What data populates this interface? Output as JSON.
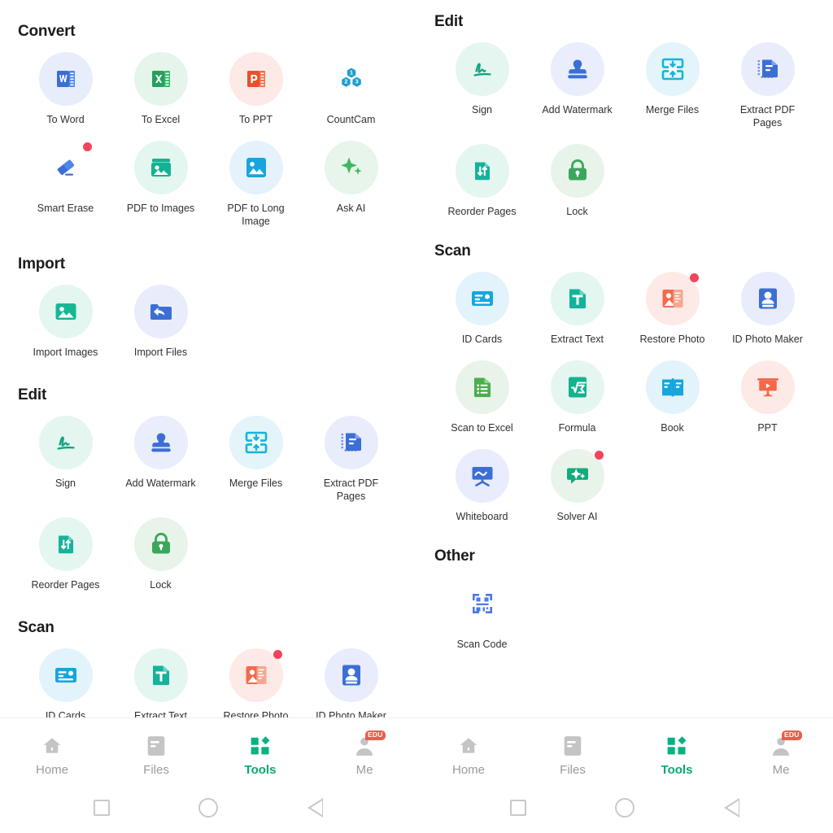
{
  "app": {
    "accent_green": "#0aa873",
    "badge_red": "#f4435a",
    "text_primary": "#2f3032",
    "text_muted": "#9a9a9a"
  },
  "left_screen": {
    "sections": [
      {
        "title": "Convert",
        "items": [
          {
            "label": "To Word",
            "icon": "word-icon",
            "bg": "#e8edfb",
            "has_badge": false
          },
          {
            "label": "To Excel",
            "icon": "excel-icon",
            "bg": "#e6f5ec",
            "has_badge": false
          },
          {
            "label": "To PPT",
            "icon": "powerpoint-icon",
            "bg": "#fdeae6",
            "has_badge": false
          },
          {
            "label": "CountCam",
            "icon": "countcam-icon",
            "bg": "transparent",
            "has_badge": false
          },
          {
            "label": "Smart Erase",
            "icon": "eraser-icon",
            "bg": "transparent",
            "has_badge": true
          },
          {
            "label": "PDF to Images",
            "icon": "image-stack-icon",
            "bg": "#e4f6f0",
            "has_badge": false
          },
          {
            "label": "PDF to Long Image",
            "icon": "long-image-icon",
            "bg": "#e5f2fb",
            "has_badge": false
          },
          {
            "label": "Ask AI",
            "icon": "sparkle-icon",
            "bg": "#e8f5ea",
            "has_badge": false
          }
        ]
      },
      {
        "title": "Import",
        "items": [
          {
            "label": "Import Images",
            "icon": "picture-icon",
            "bg": "#e4f6f0",
            "has_badge": false
          },
          {
            "label": "Import Files",
            "icon": "folder-arrow-icon",
            "bg": "#e8ecfb",
            "has_badge": false
          }
        ]
      },
      {
        "title": "Edit",
        "items": [
          {
            "label": "Sign",
            "icon": "signature-icon",
            "bg": "#e4f6ef",
            "has_badge": false
          },
          {
            "label": "Add Watermark",
            "icon": "stamp-icon",
            "bg": "#e9edfc",
            "has_badge": false
          },
          {
            "label": "Merge Files",
            "icon": "merge-icon",
            "bg": "#e3f4fa",
            "has_badge": false
          },
          {
            "label": "Extract PDF Pages",
            "icon": "extract-pages-icon",
            "bg": "#e9ecfb",
            "has_badge": false
          },
          {
            "label": "Reorder Pages",
            "icon": "reorder-icon",
            "bg": "#e4f6f0",
            "has_badge": false
          },
          {
            "label": "Lock",
            "icon": "lock-icon",
            "bg": "#e8f4ea",
            "has_badge": false
          }
        ]
      },
      {
        "title": "Scan",
        "items": [
          {
            "label": "ID Cards",
            "icon": "id-card-icon",
            "bg": "#e3f3fb",
            "has_badge": false
          },
          {
            "label": "Extract Text",
            "icon": "text-doc-icon",
            "bg": "#e3f6f0",
            "has_badge": false
          },
          {
            "label": "Restore Photo",
            "icon": "restore-photo-icon",
            "bg": "#fdeae6",
            "has_badge": true
          },
          {
            "label": "ID Photo Maker",
            "icon": "id-photo-icon",
            "bg": "#e8ecfc",
            "has_badge": false
          }
        ]
      }
    ]
  },
  "right_screen": {
    "sections": [
      {
        "title": "Edit",
        "items": [
          {
            "label": "Sign",
            "icon": "signature-icon",
            "bg": "#e4f6ef",
            "has_badge": false
          },
          {
            "label": "Add Watermark",
            "icon": "stamp-icon",
            "bg": "#e9edfc",
            "has_badge": false
          },
          {
            "label": "Merge Files",
            "icon": "merge-icon",
            "bg": "#e3f4fa",
            "has_badge": false
          },
          {
            "label": "Extract PDF Pages",
            "icon": "extract-pages-icon",
            "bg": "#e9ecfb",
            "has_badge": false
          },
          {
            "label": "Reorder Pages",
            "icon": "reorder-icon",
            "bg": "#e4f6f0",
            "has_badge": false
          },
          {
            "label": "Lock",
            "icon": "lock-icon",
            "bg": "#e8f4ea",
            "has_badge": false
          }
        ]
      },
      {
        "title": "Scan",
        "items": [
          {
            "label": "ID Cards",
            "icon": "id-card-icon",
            "bg": "#e3f3fb",
            "has_badge": false
          },
          {
            "label": "Extract Text",
            "icon": "text-doc-icon",
            "bg": "#e3f6f0",
            "has_badge": false
          },
          {
            "label": "Restore Photo",
            "icon": "restore-photo-icon",
            "bg": "#fdeae6",
            "has_badge": true
          },
          {
            "label": "ID Photo Maker",
            "icon": "id-photo-icon",
            "bg": "#e8ecfc",
            "has_badge": false
          },
          {
            "label": "Scan to Excel",
            "icon": "scan-excel-icon",
            "bg": "#e8f4ea",
            "has_badge": false
          },
          {
            "label": "Formula",
            "icon": "formula-icon",
            "bg": "#e4f6ef",
            "has_badge": false
          },
          {
            "label": "Book",
            "icon": "book-icon",
            "bg": "#e3f3fb",
            "has_badge": false
          },
          {
            "label": "PPT",
            "icon": "ppt-icon",
            "bg": "#fdeae6",
            "has_badge": false
          },
          {
            "label": "Whiteboard",
            "icon": "whiteboard-icon",
            "bg": "#e8ecfc",
            "has_badge": false
          },
          {
            "label": "Solver AI",
            "icon": "solver-ai-icon",
            "bg": "#e8f4ea",
            "has_badge": true
          }
        ]
      },
      {
        "title": "Other",
        "items": [
          {
            "label": "Scan Code",
            "icon": "qr-code-icon",
            "bg": "transparent",
            "has_badge": false
          }
        ]
      }
    ]
  },
  "bottom_nav": {
    "tabs": [
      {
        "label": "Home",
        "icon": "home-icon",
        "active": false,
        "badge": null
      },
      {
        "label": "Files",
        "icon": "files-icon",
        "active": false,
        "badge": null
      },
      {
        "label": "Tools",
        "icon": "tools-icon",
        "active": true,
        "badge": null
      },
      {
        "label": "Me",
        "icon": "person-icon",
        "active": false,
        "badge": "EDU"
      }
    ]
  },
  "system_nav": {
    "buttons": [
      {
        "label": "recents",
        "icon": "square-icon"
      },
      {
        "label": "home",
        "icon": "circle-icon"
      },
      {
        "label": "back",
        "icon": "triangle-back-icon"
      }
    ]
  }
}
